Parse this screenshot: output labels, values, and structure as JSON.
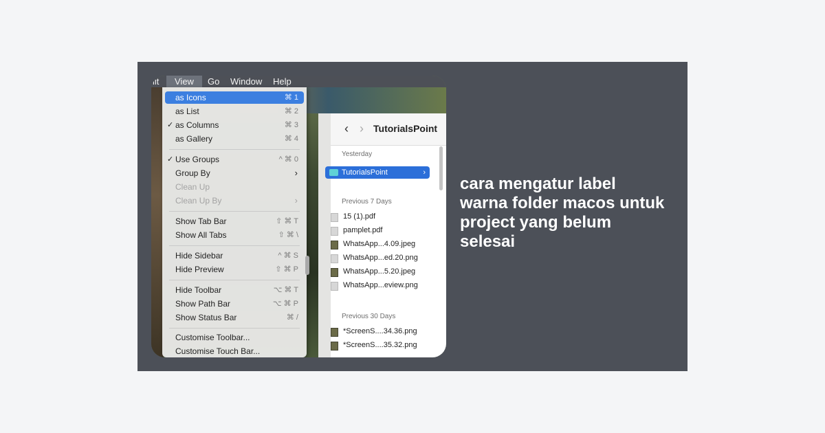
{
  "headline": "cara mengatur label warna folder macos untuk project yang belum selesai",
  "menubar": {
    "items": [
      "Edit",
      "View",
      "Go",
      "Window",
      "Help"
    ],
    "partial_first": "lit"
  },
  "view_menu": {
    "items": [
      {
        "label": "as Icons",
        "shortcut": "⌘ 1",
        "highlighted": true,
        "checked": false
      },
      {
        "label": "as List",
        "shortcut": "⌘ 2",
        "checked": false
      },
      {
        "label": "as Columns",
        "shortcut": "⌘ 3",
        "checked": true
      },
      {
        "label": "as Gallery",
        "shortcut": "⌘ 4",
        "checked": false
      },
      {
        "label": "Use Groups",
        "shortcut": "^ ⌘ 0",
        "checked": true
      },
      {
        "label": "Group By",
        "submenu": true
      },
      {
        "label": "Clean Up",
        "disabled": true
      },
      {
        "label": "Clean Up By",
        "disabled": true,
        "submenu": true
      },
      {
        "label": "Show Tab Bar",
        "shortcut": "⇧ ⌘ T"
      },
      {
        "label": "Show All Tabs",
        "shortcut": "⇧ ⌘ \\"
      },
      {
        "label": "Hide Sidebar",
        "shortcut": "^ ⌘ S"
      },
      {
        "label": "Hide Preview",
        "shortcut": "⇧ ⌘ P"
      },
      {
        "label": "Hide Toolbar",
        "shortcut": "⌥ ⌘ T"
      },
      {
        "label": "Show Path Bar",
        "shortcut": "⌥ ⌘ P"
      },
      {
        "label": "Show Status Bar",
        "shortcut": "⌘ /"
      },
      {
        "label": "Customise Toolbar..."
      },
      {
        "label": "Customise Touch Bar..."
      }
    ],
    "checkmark": "✓",
    "arrow": "›"
  },
  "finder": {
    "title": "TutorialsPoint",
    "back": "‹",
    "forward": "›",
    "sections": [
      {
        "label": "Yesterday",
        "items": [
          "TutorialsPoint"
        ]
      },
      {
        "label": "Previous 7 Days",
        "items": [
          "15 (1).pdf",
          "pamplet.pdf",
          "WhatsApp...4.09.jpeg",
          "WhatsApp...ed.20.png",
          "WhatsApp...5.20.jpeg",
          "WhatsApp...eview.png"
        ]
      },
      {
        "label": "Previous 30 Days",
        "items": [
          "*ScreenS....34.36.png",
          "*ScreenS....35.32.png"
        ]
      }
    ],
    "selected_chevron": "›"
  }
}
